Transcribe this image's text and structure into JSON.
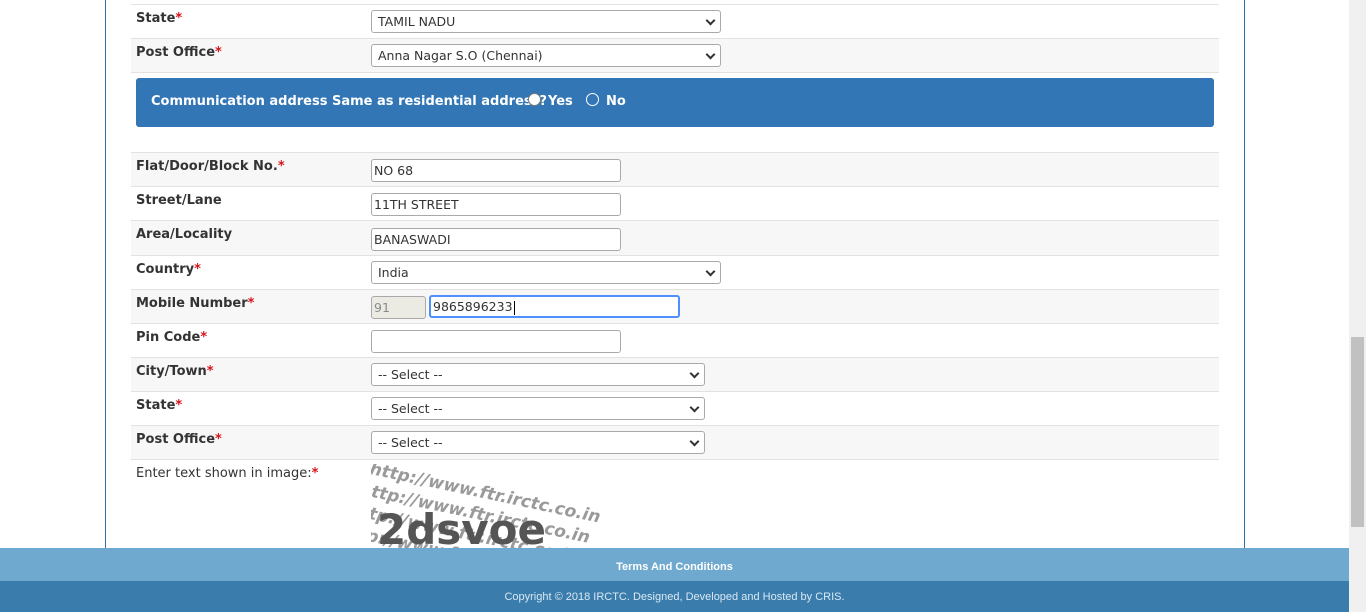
{
  "form": {
    "state_top": {
      "label": "State",
      "value": "TAMIL NADU"
    },
    "post_office_top": {
      "label": "Post Office",
      "value": "Anna Nagar S.O (Chennai)"
    },
    "comm_question": "Communication address Same as residential address?",
    "comm_yes": "Yes",
    "comm_no": "No",
    "flat": {
      "label": "Flat/Door/Block No.",
      "value": "NO 68"
    },
    "street": {
      "label": "Street/Lane",
      "value": "11TH STREET"
    },
    "area": {
      "label": "Area/Locality",
      "value": "BANASWADI"
    },
    "country": {
      "label": "Country",
      "value": "India"
    },
    "mobile": {
      "label": "Mobile Number",
      "code": "91",
      "value": "9865896233"
    },
    "pin": {
      "label": "Pin Code",
      "value": ""
    },
    "city": {
      "label": "City/Town",
      "value": "-- Select --"
    },
    "state": {
      "label": "State",
      "value": "-- Select --"
    },
    "post_office": {
      "label": "Post Office",
      "value": "-- Select --"
    },
    "captcha": {
      "label": "Enter text shown in image:",
      "text": "2dsvoe",
      "watermark": "http://www.ftr.irctc.co.in"
    },
    "required_mark": "*"
  },
  "footer": {
    "terms": "Terms And Conditions",
    "copyright": "Copyright © 2018 IRCTC. Designed, Developed and Hosted by CRIS."
  },
  "colors": {
    "banner": "#3276b5",
    "footer_light": "#6fa9cf",
    "footer_dark": "#3a7dac",
    "required": "#d9131a"
  }
}
